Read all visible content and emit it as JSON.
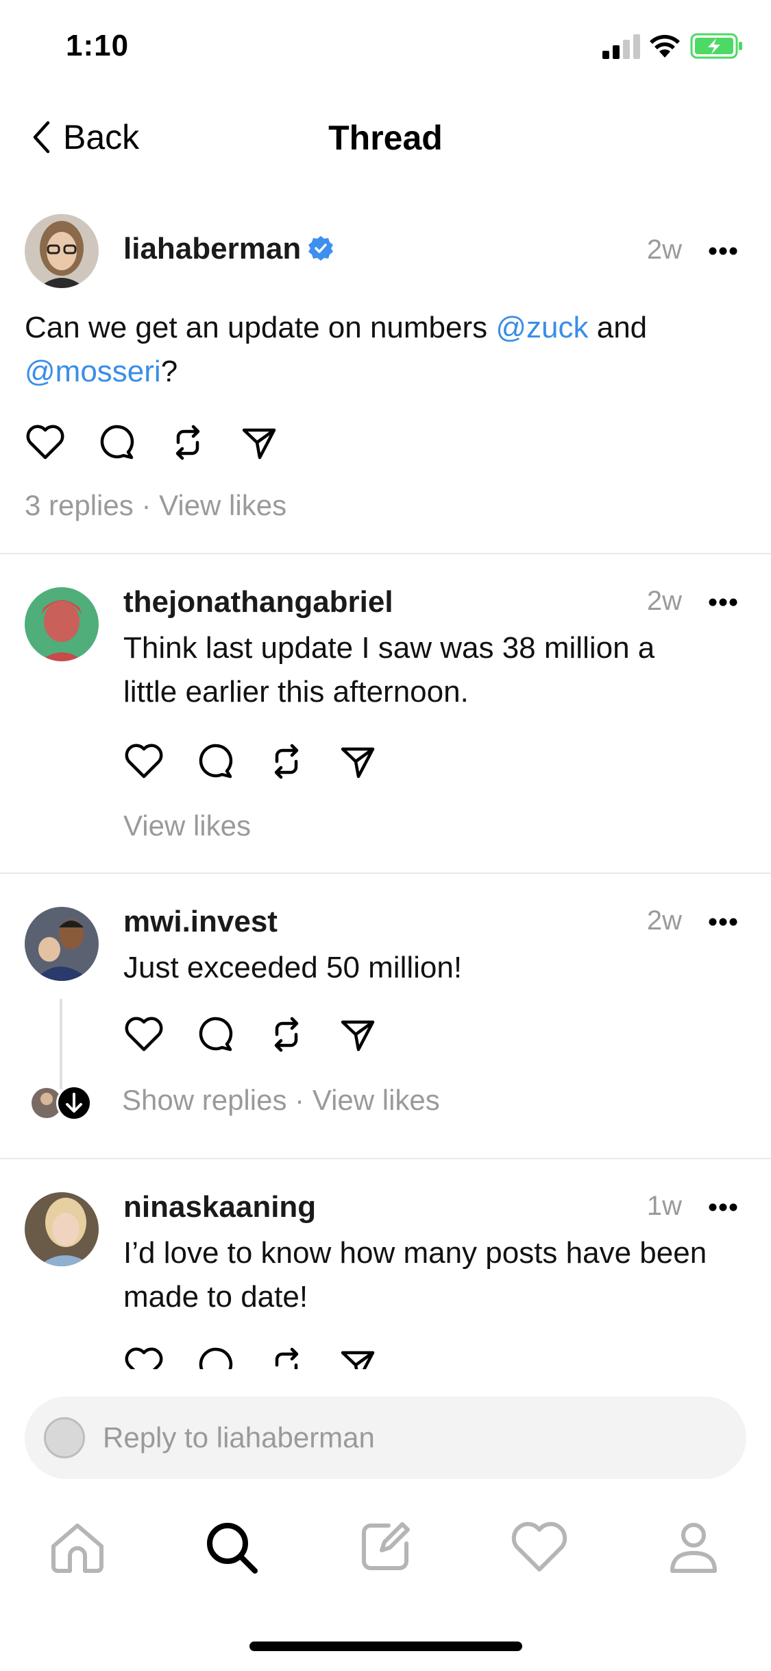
{
  "status": {
    "time": "1:10"
  },
  "header": {
    "back_label": "Back",
    "title": "Thread"
  },
  "main_post": {
    "username": "liahaberman",
    "verified": true,
    "time": "2w",
    "text_before": "Can we get an update on numbers ",
    "mention1": "@zuck",
    "text_mid": " and ",
    "mention2": "@mosseri",
    "text_after": "?",
    "replies_label": "3 replies",
    "separator": "·",
    "view_likes": "View likes"
  },
  "replies": [
    {
      "username": "thejonathangabriel",
      "time": "2w",
      "text": "Think last update I saw was 38 million a little earlier this afternoon.",
      "view_likes": "View likes"
    },
    {
      "username": "mwi.invest",
      "time": "2w",
      "text": "Just exceeded 50 million!",
      "show_replies": "Show replies",
      "separator": "·",
      "view_likes": "View likes"
    },
    {
      "username": "ninaskaaning",
      "time": "1w",
      "text": "I’d love to know how many posts have been made to date!"
    }
  ],
  "reply_box": {
    "placeholder": "Reply to liahaberman"
  },
  "tabs": [
    "home-icon",
    "search-icon",
    "compose-icon",
    "activity-icon",
    "profile-icon"
  ],
  "colors": {
    "mention": "#3a8ee6",
    "verified": "#3d8ff0",
    "muted": "#9a9a9a",
    "battery": "#4cd964"
  }
}
